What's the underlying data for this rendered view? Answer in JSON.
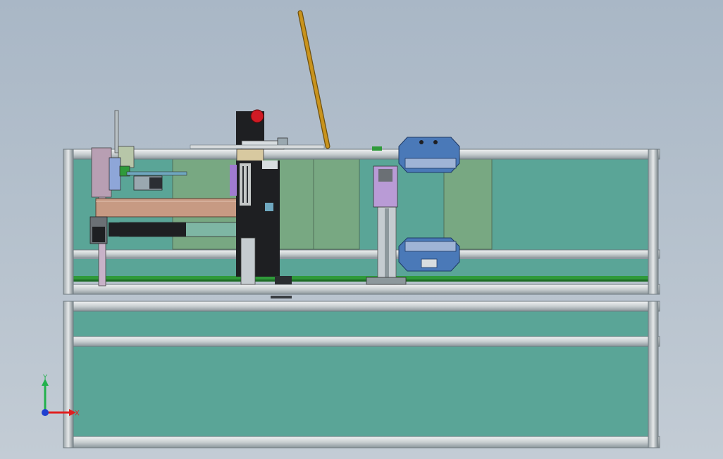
{
  "viewport": {
    "background_top": "#a9b7c6",
    "background_bottom": "#c3ccd5"
  },
  "colors": {
    "frame_rail": "#d7dbdd",
    "frame_dark": "#6f7a80",
    "panel_teal": "#5aa597",
    "panel_green": "#78a882",
    "belt_green": "#2f9a3a",
    "plate_brown": "#c79a83",
    "plate_blue": "#4a79b8",
    "plate_purple": "#a07bd0",
    "warning_red": "#d01a24",
    "rod_orange": "#c9931c",
    "column_dark": "#1e1f22"
  },
  "triad": {
    "y_label": "Y",
    "x_label": "X",
    "y_color": "#22b14c",
    "x_color": "#e02020",
    "z_color": "#2040d0"
  }
}
